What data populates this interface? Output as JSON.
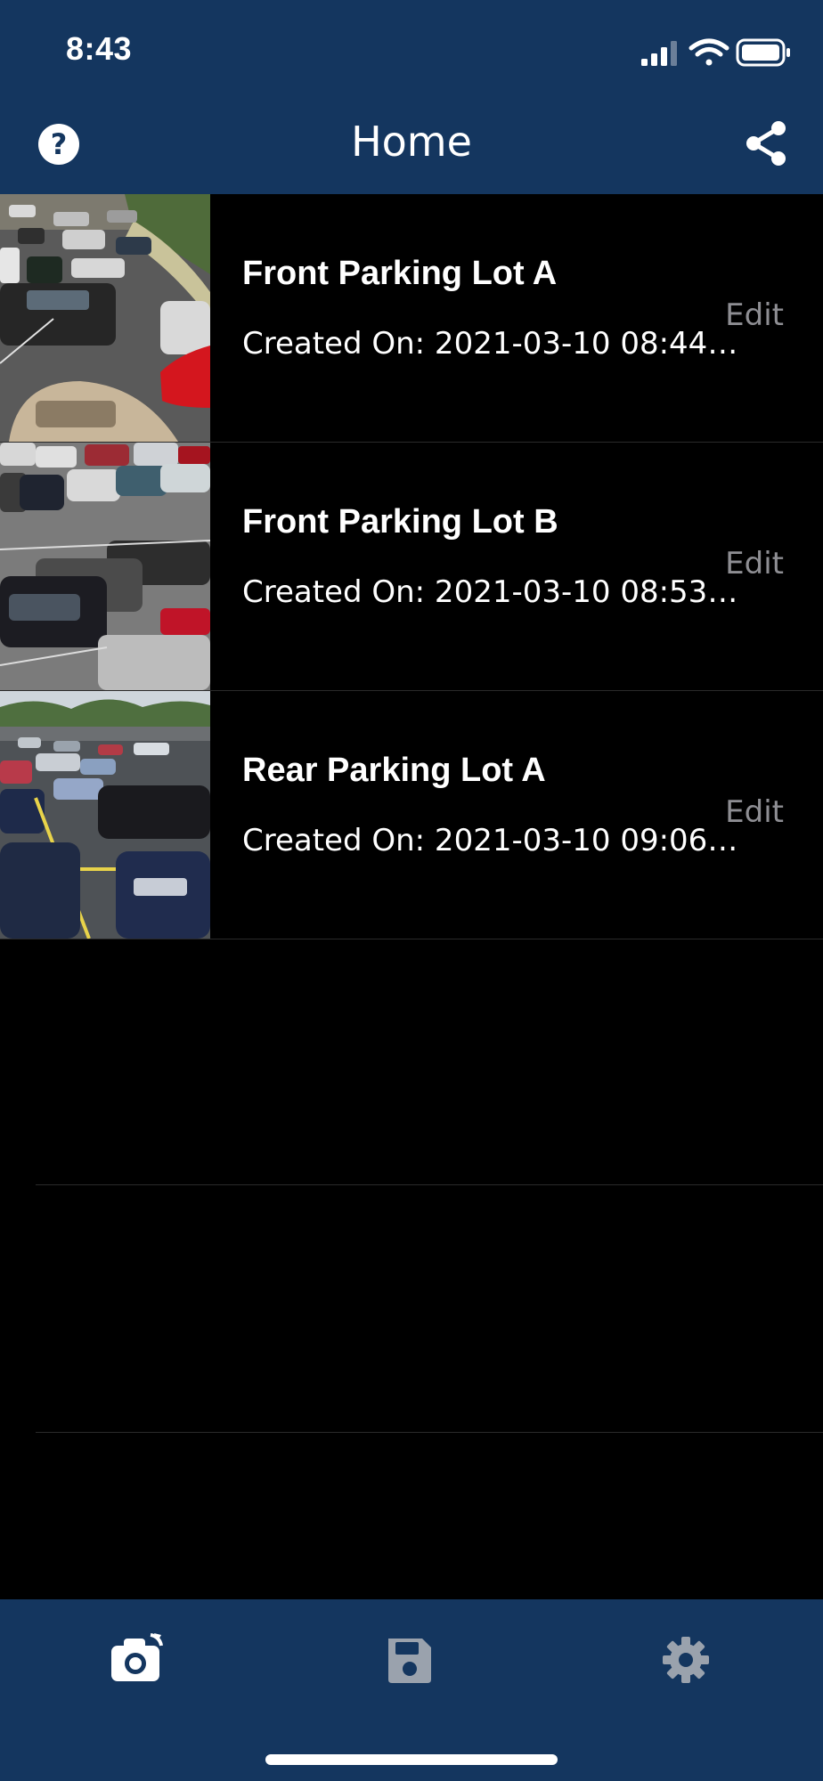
{
  "status_bar": {
    "time": "8:43"
  },
  "nav": {
    "title": "Home"
  },
  "rows": [
    {
      "title": "Front Parking Lot A",
      "subtitle": "Created On: 2021-03-10 08:44:…",
      "edit_label": "Edit"
    },
    {
      "title": "Front Parking Lot B",
      "subtitle": "Created On: 2021-03-10 08:53:…",
      "edit_label": "Edit"
    },
    {
      "title": "Rear Parking Lot A",
      "subtitle": "Created On: 2021-03-10 09:06:…",
      "edit_label": "Edit"
    }
  ],
  "tabs": [
    {
      "icon": "camera-icon",
      "active": true
    },
    {
      "icon": "save-icon",
      "active": false
    },
    {
      "icon": "gear-icon",
      "active": false
    }
  ],
  "colors": {
    "nav_background": "#14365f",
    "edit_text": "#8e8e93",
    "inactive_tab": "#9aa2ad"
  }
}
